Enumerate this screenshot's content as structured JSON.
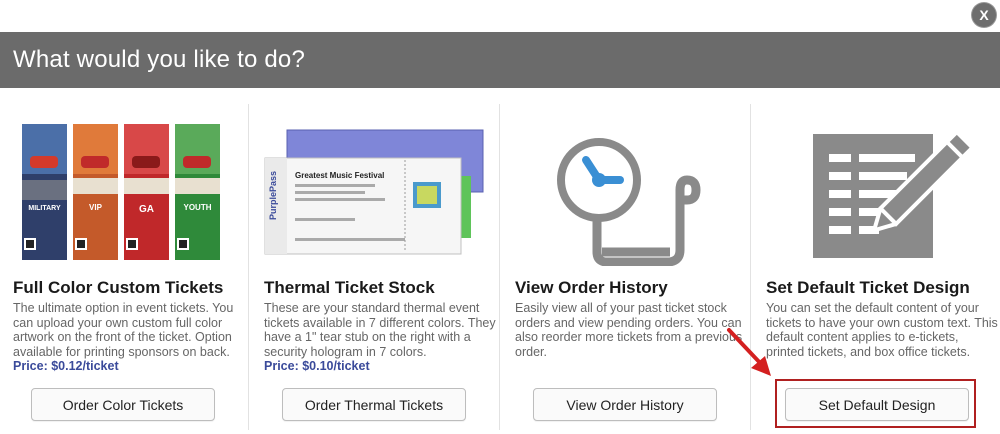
{
  "dialog": {
    "close_label": "X",
    "title": "What would you like to do?"
  },
  "options": [
    {
      "title": "Full Color Custom Tickets",
      "description": "The ultimate option in event tickets. You can upload your own custom full color artwork on the front of the ticket. Option available for printing sponsors on back.",
      "price": "Price: $0.12/ticket",
      "button": "Order Color Tickets",
      "ticket_labels": [
        "MILITARY",
        "VIP",
        "GA",
        "YOUTH"
      ]
    },
    {
      "title": "Thermal Ticket Stock",
      "description": "These are your standard thermal event tickets available in 7 different colors. They have a 1\" tear stub on the right with a security hologram in 7 colors.",
      "price": "Price: $0.10/ticket",
      "button": "Order Thermal Tickets",
      "ticket_event": "Greatest Music Festival"
    },
    {
      "title": "View Order History",
      "description": "Easily view all of your past ticket stock orders and view pending orders. You can also reorder more tickets from a previous order.",
      "button": "View Order History"
    },
    {
      "title": "Set Default Ticket Design",
      "description": "You can set the default content of your tickets to have your own custom text. This default content applies to e-tickets, printed tickets, and box office tickets.",
      "button": "Set Default Design"
    }
  ],
  "colors": {
    "header_bg": "#6b6b6b",
    "price": "#3a4a9a",
    "highlight": "#b02020",
    "icon_gray": "#8a8a8a",
    "clock_blue": "#3a8fd4"
  },
  "icons": [
    "close-icon",
    "clock-scroll-icon",
    "document-pencil-icon",
    "red-arrow-icon"
  ]
}
